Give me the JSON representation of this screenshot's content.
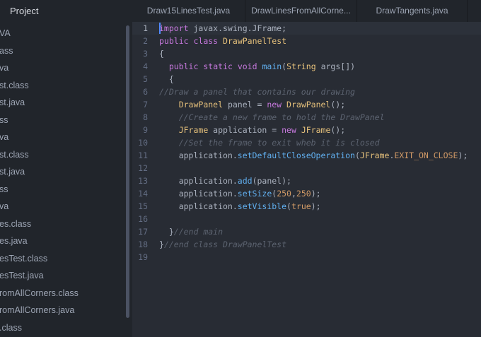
{
  "sidebar": {
    "title": "Project",
    "items": [
      "VA",
      "ass",
      "va",
      "st.class",
      "st.java",
      "ss",
      "va",
      "st.class",
      "st.java",
      "ss",
      "va",
      "es.class",
      "es.java",
      "esTest.class",
      "esTest.java",
      "romAllCorners.class",
      "romAllCorners.java",
      ".class"
    ]
  },
  "tabs": [
    {
      "label": "Draw15LinesTest.java"
    },
    {
      "label": "DrawLinesFromAllCorne..."
    },
    {
      "label": "DrawTangents.java"
    }
  ],
  "editor": {
    "current_line": 1,
    "lines": [
      {
        "num": "1",
        "tokens": [
          {
            "t": "kw",
            "v": "import"
          },
          {
            "t": "plain",
            "v": " javax.swing.JFrame;"
          }
        ]
      },
      {
        "num": "2",
        "tokens": [
          {
            "t": "kw",
            "v": "public"
          },
          {
            "t": "plain",
            "v": " "
          },
          {
            "t": "kw",
            "v": "class"
          },
          {
            "t": "plain",
            "v": " "
          },
          {
            "t": "type",
            "v": "DrawPanelTest"
          }
        ]
      },
      {
        "num": "3",
        "tokens": [
          {
            "t": "plain",
            "v": "{"
          }
        ]
      },
      {
        "num": "4",
        "tokens": [
          {
            "t": "plain",
            "v": "  "
          },
          {
            "t": "kw",
            "v": "public"
          },
          {
            "t": "plain",
            "v": " "
          },
          {
            "t": "kw",
            "v": "static"
          },
          {
            "t": "plain",
            "v": " "
          },
          {
            "t": "kw",
            "v": "void"
          },
          {
            "t": "plain",
            "v": " "
          },
          {
            "t": "fn",
            "v": "main"
          },
          {
            "t": "plain",
            "v": "("
          },
          {
            "t": "type",
            "v": "String"
          },
          {
            "t": "plain",
            "v": " args[])"
          }
        ]
      },
      {
        "num": "5",
        "tokens": [
          {
            "t": "plain",
            "v": "  {"
          }
        ]
      },
      {
        "num": "6",
        "tokens": [
          {
            "t": "comment",
            "v": "//Draw a panel that contains our drawing"
          }
        ]
      },
      {
        "num": "7",
        "tokens": [
          {
            "t": "plain",
            "v": "    "
          },
          {
            "t": "type",
            "v": "DrawPanel"
          },
          {
            "t": "plain",
            "v": " panel = "
          },
          {
            "t": "kw",
            "v": "new"
          },
          {
            "t": "plain",
            "v": " "
          },
          {
            "t": "type",
            "v": "DrawPanel"
          },
          {
            "t": "plain",
            "v": "();"
          }
        ]
      },
      {
        "num": "8",
        "tokens": [
          {
            "t": "plain",
            "v": "    "
          },
          {
            "t": "comment",
            "v": "//Create a new frame to hold the DrawPanel"
          }
        ]
      },
      {
        "num": "9",
        "tokens": [
          {
            "t": "plain",
            "v": "    "
          },
          {
            "t": "type",
            "v": "JFrame"
          },
          {
            "t": "plain",
            "v": " application = "
          },
          {
            "t": "kw",
            "v": "new"
          },
          {
            "t": "plain",
            "v": " "
          },
          {
            "t": "type",
            "v": "JFrame"
          },
          {
            "t": "plain",
            "v": "();"
          }
        ]
      },
      {
        "num": "10",
        "tokens": [
          {
            "t": "plain",
            "v": "    "
          },
          {
            "t": "comment",
            "v": "//Set the frame to exit wheb it is closed"
          }
        ]
      },
      {
        "num": "11",
        "tokens": [
          {
            "t": "plain",
            "v": "    application."
          },
          {
            "t": "fn",
            "v": "setDefaultCloseOperation"
          },
          {
            "t": "plain",
            "v": "("
          },
          {
            "t": "type",
            "v": "JFrame"
          },
          {
            "t": "plain",
            "v": "."
          },
          {
            "t": "const",
            "v": "EXIT_ON_CLOSE"
          },
          {
            "t": "plain",
            "v": ");"
          }
        ]
      },
      {
        "num": "12",
        "tokens": []
      },
      {
        "num": "13",
        "tokens": [
          {
            "t": "plain",
            "v": "    application."
          },
          {
            "t": "fn",
            "v": "add"
          },
          {
            "t": "plain",
            "v": "(panel);"
          }
        ]
      },
      {
        "num": "14",
        "tokens": [
          {
            "t": "plain",
            "v": "    application."
          },
          {
            "t": "fn",
            "v": "setSize"
          },
          {
            "t": "plain",
            "v": "("
          },
          {
            "t": "num",
            "v": "250"
          },
          {
            "t": "plain",
            "v": ","
          },
          {
            "t": "num",
            "v": "250"
          },
          {
            "t": "plain",
            "v": ");"
          }
        ]
      },
      {
        "num": "15",
        "tokens": [
          {
            "t": "plain",
            "v": "    application."
          },
          {
            "t": "fn",
            "v": "setVisible"
          },
          {
            "t": "plain",
            "v": "("
          },
          {
            "t": "bool",
            "v": "true"
          },
          {
            "t": "plain",
            "v": ");"
          }
        ]
      },
      {
        "num": "16",
        "tokens": []
      },
      {
        "num": "17",
        "tokens": [
          {
            "t": "plain",
            "v": "  }"
          },
          {
            "t": "comment",
            "v": "//end main"
          }
        ]
      },
      {
        "num": "18",
        "tokens": [
          {
            "t": "plain",
            "v": "}"
          },
          {
            "t": "comment",
            "v": "//end class DrawPanelTest"
          }
        ]
      },
      {
        "num": "19",
        "tokens": []
      }
    ]
  },
  "colors": {
    "background": "#282c34",
    "sidebar": "#21252b",
    "keyword": "#c678dd",
    "type": "#e5c07b",
    "function": "#61afef",
    "comment": "#5c6370",
    "number": "#d19a66"
  }
}
